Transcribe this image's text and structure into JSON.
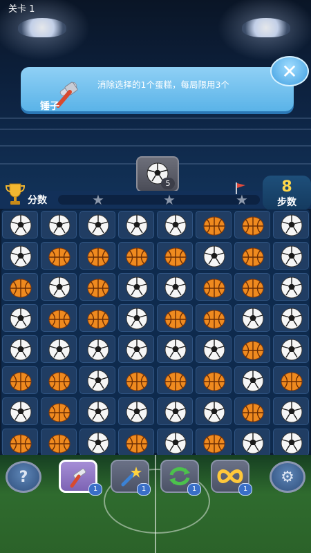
{
  "level": {
    "label": "关卡 1"
  },
  "tooltip": {
    "title": "锤子",
    "description": "消除选择的1个蛋糕，每局限用3个",
    "close_icon": "close-icon"
  },
  "goal": {
    "icon": "soccer-ball-icon",
    "count": "5"
  },
  "score": {
    "label": "分数",
    "progress": 0
  },
  "moves": {
    "value": "8",
    "label": "步数"
  },
  "board": {
    "rows": [
      [
        "soccer",
        "soccer",
        "soccer",
        "soccer",
        "soccer",
        "basketball",
        "basketball",
        "soccer"
      ],
      [
        "soccer",
        "basketball",
        "basketball",
        "basketball",
        "basketball",
        "soccer",
        "basketball",
        "soccer"
      ],
      [
        "basketball",
        "soccer",
        "basketball",
        "soccer",
        "soccer",
        "basketball",
        "basketball",
        "soccer"
      ],
      [
        "soccer",
        "basketball",
        "basketball",
        "soccer",
        "basketball",
        "basketball",
        "soccer",
        "soccer"
      ],
      [
        "soccer",
        "soccer",
        "soccer",
        "soccer",
        "soccer",
        "soccer",
        "basketball",
        "soccer"
      ],
      [
        "basketball",
        "basketball",
        "soccer",
        "basketball",
        "basketball",
        "basketball",
        "soccer",
        "basketball"
      ],
      [
        "soccer",
        "basketball",
        "soccer",
        "soccer",
        "soccer",
        "soccer",
        "basketball",
        "soccer"
      ],
      [
        "basketball",
        "basketball",
        "soccer",
        "basketball",
        "soccer",
        "basketball",
        "soccer",
        "soccer"
      ]
    ]
  },
  "tools": [
    {
      "name": "hammer",
      "icon": "hammer-icon",
      "count": "1",
      "selected": true
    },
    {
      "name": "magic-wand",
      "icon": "wand-icon",
      "count": "1",
      "selected": false
    },
    {
      "name": "shuffle",
      "icon": "shuffle-icon",
      "count": "1",
      "selected": false
    },
    {
      "name": "infinite-moves",
      "icon": "infinity-icon",
      "count": "1",
      "selected": false
    }
  ],
  "help_button": {
    "label": "?",
    "icon": "help-icon"
  },
  "settings_button": {
    "icon": "gear-icon"
  },
  "colors": {
    "accent": "#5ab3e8",
    "moves": "#ffd84a",
    "board": "#0e2a4d"
  }
}
